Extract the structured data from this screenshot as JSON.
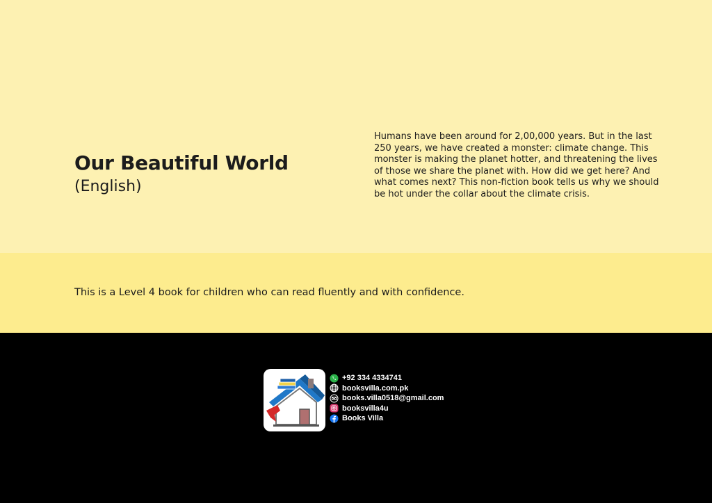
{
  "book": {
    "title": "Our Beautiful World",
    "subtitle": "(English)",
    "blurb": "Humans have been around for 2,00,000 years. But in the last 250 years, we have created a monster: climate change. This monster is making the planet hotter, and threatening the lives of those we share the planet with. How did we get here? And what comes next? This non-fiction book tells us why we should be hot under the collar about the climate crisis.",
    "level_note": "This is a Level 4 book for children who can read fluently and with confidence."
  },
  "publisher": {
    "logo_icon": "books-villa-house-logo",
    "contacts": [
      {
        "icon": "whatsapp-icon",
        "text": "+92 334 4334741"
      },
      {
        "icon": "globe-icon",
        "text": "booksvilla.com.pk"
      },
      {
        "icon": "email-icon",
        "text": "books.villa0518@gmail.com"
      },
      {
        "icon": "instagram-icon",
        "text": "booksvilla4u"
      },
      {
        "icon": "facebook-icon",
        "text": "Books Villa"
      }
    ]
  },
  "colors": {
    "top_band": "#fdf1b2",
    "middle_band": "#fdec8e",
    "footer": "#000000"
  }
}
